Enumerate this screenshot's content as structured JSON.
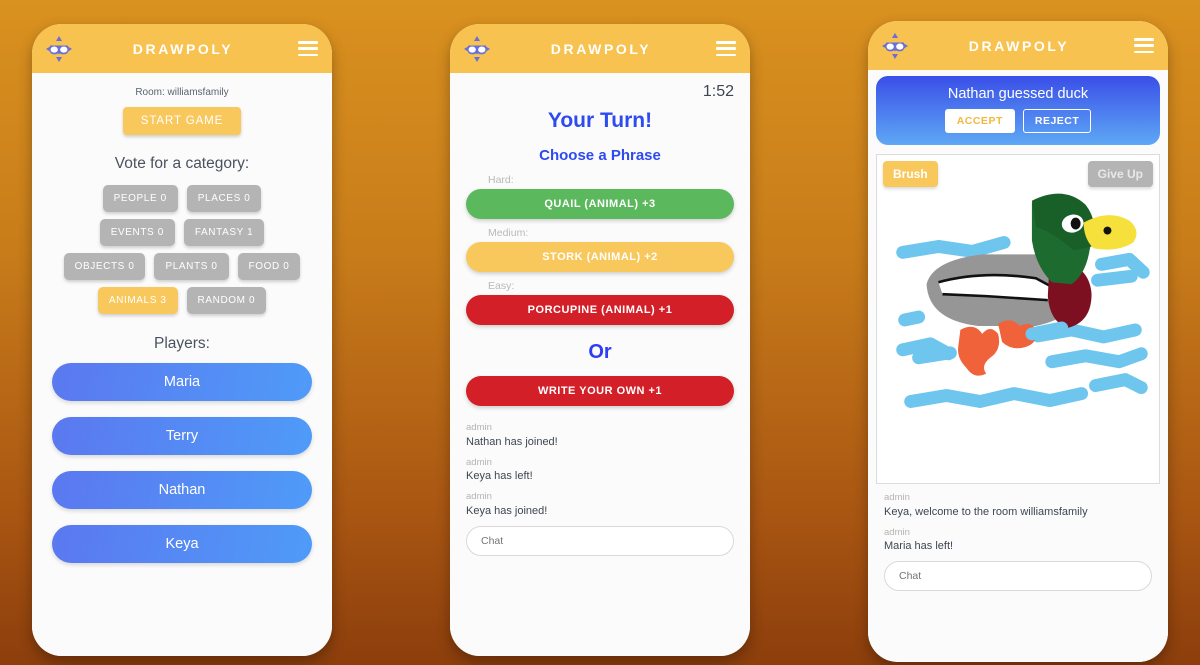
{
  "app": {
    "brand": "DRAWPOLY",
    "logo_icon": "drawpoly-logo-icon",
    "menu_icon": "hamburger-menu-icon",
    "background_top_color": "#d9911f",
    "background_bottom_color": "#8c3e0c"
  },
  "phone1": {
    "room_label": "Room: williamsfamily",
    "start_button": "START GAME",
    "vote_title": "Vote for a category:",
    "categories": [
      [
        {
          "label": "PEOPLE 0",
          "selected": false
        },
        {
          "label": "PLACES 0",
          "selected": false
        }
      ],
      [
        {
          "label": "EVENTS 0",
          "selected": false
        },
        {
          "label": "FANTASY 1",
          "selected": false
        }
      ],
      [
        {
          "label": "OBJECTS 0",
          "selected": false
        },
        {
          "label": "PLANTS 0",
          "selected": false
        },
        {
          "label": "FOOD 0",
          "selected": false
        }
      ],
      [
        {
          "label": "ANIMALS 3",
          "selected": true
        },
        {
          "label": "RANDOM 0",
          "selected": false
        }
      ]
    ],
    "players_title": "Players:",
    "players": [
      "Maria",
      "Terry",
      "Nathan",
      "Keya"
    ],
    "selected_color": "#f9c85c",
    "unselected_color": "#b4b4b4",
    "player_color": "#4f8cf8"
  },
  "phone2": {
    "timer": "1:52",
    "turn_title": "Your Turn!",
    "choose_title": "Choose a Phrase",
    "phrases": [
      {
        "difficulty": "Hard:",
        "label": "QUAIL (ANIMAL) +3",
        "color": "#5cb85c"
      },
      {
        "difficulty": "Medium:",
        "label": "STORK (ANIMAL) +2",
        "color": "#f9c85c"
      },
      {
        "difficulty": "Easy:",
        "label": "PORCUPINE (ANIMAL) +1",
        "color": "#d32028"
      }
    ],
    "or_text": "Or",
    "write_own_label": "WRITE YOUR OWN +1",
    "chat_messages": [
      {
        "author": "admin",
        "text": "Nathan has joined!"
      },
      {
        "author": "admin",
        "text": "Keya has left!"
      },
      {
        "author": "admin",
        "text": "Keya has joined!"
      }
    ],
    "chat_placeholder": "Chat"
  },
  "phone3": {
    "guess_text": "Nathan guessed duck",
    "accept_label": "ACCEPT",
    "reject_label": "REJECT",
    "brush_label": "Brush",
    "giveup_label": "Give Up",
    "drawing_description": "duck-drawing",
    "chat_messages": [
      {
        "author": "admin",
        "text": "Keya, welcome to the room williamsfamily"
      },
      {
        "author": "admin",
        "text": "Maria has left!"
      }
    ],
    "chat_placeholder": "Chat"
  }
}
